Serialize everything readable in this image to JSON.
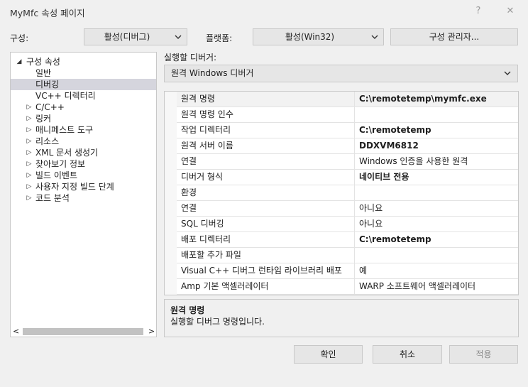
{
  "window": {
    "title": "MyMfc 속성 페이지",
    "help_glyph": "?",
    "close_glyph": "✕"
  },
  "config": {
    "label": "구성:",
    "value": "활성(디버그)"
  },
  "platform": {
    "label": "플랫폼:",
    "value": "활성(Win32)"
  },
  "config_manager_button": "구성 관리자...",
  "tree": {
    "root": "구성 속성",
    "items": [
      {
        "label": "일반",
        "expandable": false,
        "selected": false
      },
      {
        "label": "디버깅",
        "expandable": false,
        "selected": true
      },
      {
        "label": "VC++ 디렉터리",
        "expandable": false,
        "selected": false
      },
      {
        "label": "C/C++",
        "expandable": true,
        "selected": false
      },
      {
        "label": "링커",
        "expandable": true,
        "selected": false
      },
      {
        "label": "매니페스트 도구",
        "expandable": true,
        "selected": false
      },
      {
        "label": "리소스",
        "expandable": true,
        "selected": false
      },
      {
        "label": "XML 문서 생성기",
        "expandable": true,
        "selected": false
      },
      {
        "label": "찾아보기 정보",
        "expandable": true,
        "selected": false
      },
      {
        "label": "빌드 이벤트",
        "expandable": true,
        "selected": false
      },
      {
        "label": "사용자 지정 빌드 단계",
        "expandable": true,
        "selected": false
      },
      {
        "label": "코드 분석",
        "expandable": true,
        "selected": false
      }
    ],
    "scroll_left": "<",
    "scroll_right": ">"
  },
  "debugger": {
    "label": "실행할 디버거:",
    "value": "원격 Windows 디버거"
  },
  "properties": [
    {
      "name": "원격 명령",
      "value": "C:\\remotetemp\\mymfc.exe",
      "bold": true
    },
    {
      "name": "원격 명령 인수",
      "value": "",
      "bold": false
    },
    {
      "name": "작업 디렉터리",
      "value": "C:\\remotetemp",
      "bold": true
    },
    {
      "name": "원격 서버 이름",
      "value": "DDXVM6812",
      "bold": true
    },
    {
      "name": "연결",
      "value": "Windows 인증을 사용한 원격",
      "bold": false
    },
    {
      "name": "디버거 형식",
      "value": "네이티브 전용",
      "bold": true
    },
    {
      "name": "환경",
      "value": "",
      "bold": false
    },
    {
      "name": "연결",
      "value": "아니요",
      "bold": false
    },
    {
      "name": "SQL 디버깅",
      "value": "아니요",
      "bold": false
    },
    {
      "name": "배포 디렉터리",
      "value": "C:\\remotetemp",
      "bold": true
    },
    {
      "name": "배포할 추가 파일",
      "value": "",
      "bold": false
    },
    {
      "name": "Visual C++ 디버그 런타임 라이브러리 배포",
      "value": "예",
      "bold": false
    },
    {
      "name": "Amp 기본 액셀러레이터",
      "value": "WARP 소프트웨어 액셀러레이터",
      "bold": false
    }
  ],
  "description": {
    "title": "원격 명령",
    "text": "실행할 디버그 명령입니다."
  },
  "buttons": {
    "ok": "확인",
    "cancel": "취소",
    "apply": "적용"
  },
  "colors": {
    "selection": "#d5d5dd",
    "window_bg": "#f0f0f0",
    "disabled_text": "#8c8c8c"
  }
}
